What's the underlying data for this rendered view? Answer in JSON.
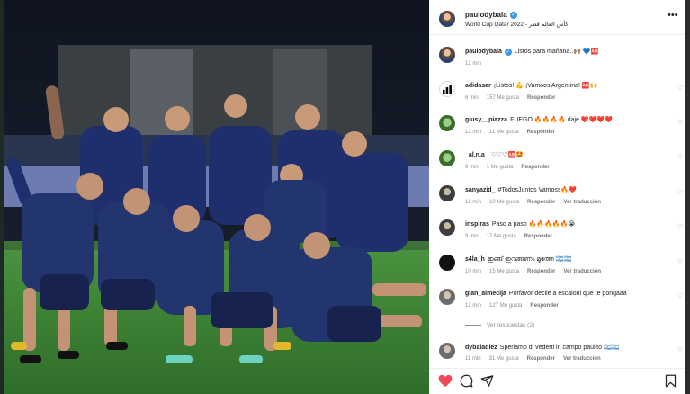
{
  "post": {
    "username": "paulodybala",
    "location": "World Cup Qatar 2022 - كأس العالم قطر",
    "caption": {
      "username": "paulodybala",
      "text": "Listos para mañana..🙌🏽 💙🆎",
      "time": "12 min"
    }
  },
  "comments": [
    {
      "username": "adidasar",
      "text": "¡Listos! 💪 ¡Vamoos Argentina! 🆎🙌",
      "time": "6 min",
      "likes": "157 Me gusta",
      "reply": "Responder",
      "extra": "",
      "avatar": "adidas-logo"
    },
    {
      "username": "giusy__piazza",
      "text": "FUEGO 🔥🔥🔥🔥 daje ❤️❤️❤️❤️",
      "time": "12 min",
      "likes": "11 Me gusta",
      "reply": "Responder",
      "extra": "",
      "avatar": "user-photo"
    },
    {
      "username": "_al.n.a_",
      "text": "♡♡♡🆎🤩",
      "time": "9 min",
      "likes": "1 Me gusta",
      "reply": "Responder",
      "extra": "",
      "avatar": "user-photo"
    },
    {
      "username": "sanyazid_",
      "text": "#TodosJuntos Vamoss🔥❤️",
      "time": "12 min",
      "likes": "10 Me gusta",
      "reply": "Responder",
      "extra": "Ver traducción",
      "avatar": "user-photo"
    },
    {
      "username": "inspiras",
      "text": "Paso a paso 🔥🔥🔥🔥🔥😭",
      "time": "9 min",
      "likes": "17 Me gusta",
      "reply": "Responder",
      "extra": "",
      "avatar": "user-photo"
    },
    {
      "username": "s4la_h",
      "text": "ഇങ്ങ് ഇറങ്ങണം മുത്തേ 🇦🇷🇦🇷",
      "time": "10 min",
      "likes": "15 Me gusta",
      "reply": "Responder",
      "extra": "Ver traducción",
      "avatar": "black-circle"
    },
    {
      "username": "gian_almecija",
      "text": "Porfavor decile a escaloni que te pongaaa",
      "time": "12 min",
      "likes": "127 Me gusta",
      "reply": "Responder",
      "extra": "",
      "avatar": "user-photo"
    },
    {
      "username": "dybaladiez",
      "text": "Speriamo di vederti in campo paulito 🇦🇷🇦🇷",
      "time": "11 min",
      "likes": "31 Me gusta",
      "reply": "Responder",
      "extra": "Ver traducción",
      "avatar": "user-photo"
    }
  ],
  "view_replies": "Ver respuestas (2)",
  "icons": {
    "more": "more-horizontal-icon",
    "verified": "verified-badge-icon",
    "comment_heart": "heart-outline-icon",
    "like": "heart-filled-icon",
    "comment": "comment-icon",
    "share": "share-icon",
    "save": "bookmark-icon"
  },
  "colors": {
    "like_red": "#ed4956",
    "verified_blue": "#3897f0",
    "secondary_text": "#8e8e8e",
    "kit_navy": "#1f2f6e",
    "pitch_green": "#3f8a3a"
  }
}
